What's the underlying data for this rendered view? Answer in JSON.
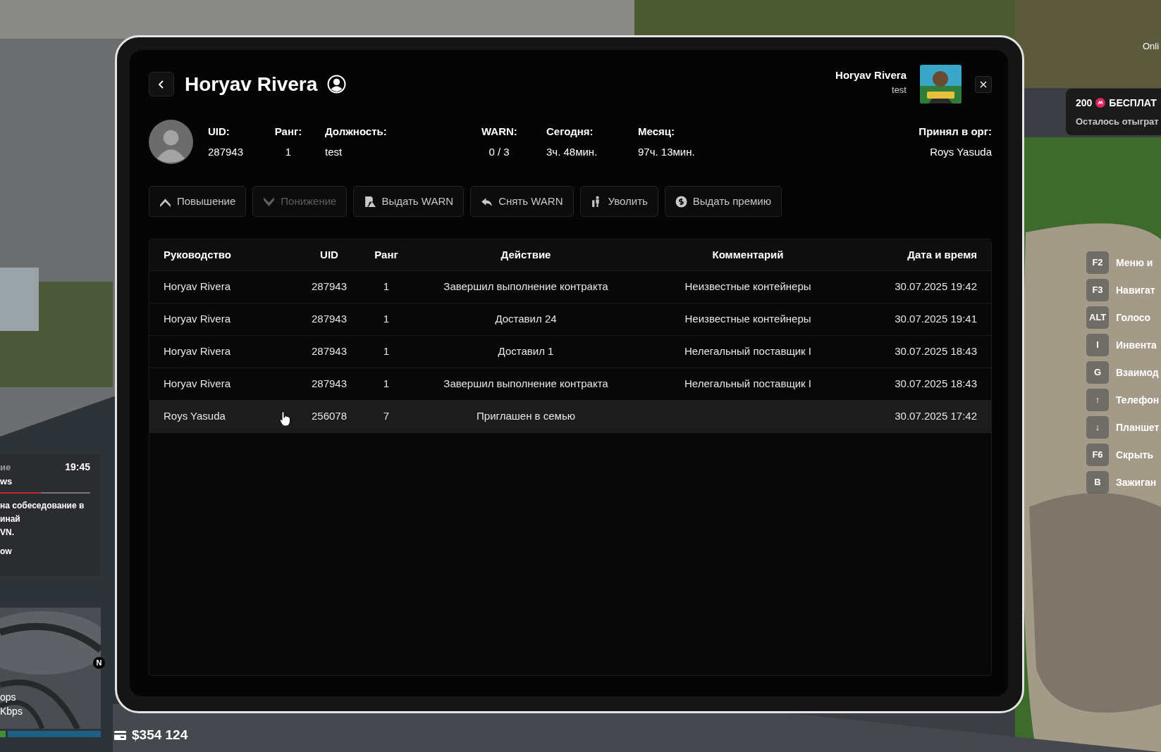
{
  "hud": {
    "top_right": {
      "status": "Onli"
    },
    "promo": {
      "amount": "200",
      "title": "БЕСПЛАТ",
      "subtitle": "Осталось отыграт"
    },
    "keybinds": [
      {
        "key": "F2",
        "label": "Меню и"
      },
      {
        "key": "F3",
        "label": "Навигат"
      },
      {
        "key": "ALT",
        "label": "Голосо"
      },
      {
        "key": "I",
        "label": "Инвента"
      },
      {
        "key": "G",
        "label": "Взаимод"
      },
      {
        "key": "↑",
        "label": "Телефон"
      },
      {
        "key": "↓",
        "label": "Планшет"
      },
      {
        "key": "F6",
        "label": "Скрыть"
      },
      {
        "key": "B",
        "label": "Зажиган"
      }
    ],
    "chat": {
      "title": "ие",
      "time": "19:45",
      "sender": "ws",
      "level": 0.45,
      "lines": [
        "на собеседование в",
        "инай",
        "VN."
      ],
      "footer": "ow"
    },
    "minimap": {
      "compass": "N",
      "net_lines": [
        "ops",
        "Kbps"
      ]
    },
    "money": {
      "bank": "$354 124"
    }
  },
  "tablet": {
    "title": "Horyav Rivera",
    "user": {
      "name": "Horyav Rivera",
      "role": "test"
    },
    "stats": [
      {
        "label": "UID:",
        "value": "287943"
      },
      {
        "label": "Ранг:",
        "value": "1"
      },
      {
        "label": "Должность:",
        "value": "test"
      },
      {
        "label": "WARN:",
        "value": "0 / 3"
      },
      {
        "label": "Сегодня:",
        "value": "3ч. 48мин."
      },
      {
        "label": "Месяц:",
        "value": "97ч. 13мин."
      }
    ],
    "accepted": {
      "label": "Принял в орг:",
      "value": "Roys Yasuda"
    },
    "actions": [
      {
        "label": "Повышение",
        "kind": "up",
        "disabled": false
      },
      {
        "label": "Понижение",
        "kind": "down",
        "disabled": true
      },
      {
        "label": "Выдать WARN",
        "kind": "warn",
        "disabled": false
      },
      {
        "label": "Снять WARN",
        "kind": "undo",
        "disabled": false
      },
      {
        "label": "Уволить",
        "kind": "fire",
        "disabled": false
      },
      {
        "label": "Выдать премию",
        "kind": "coin",
        "disabled": false
      }
    ],
    "table": {
      "columns": [
        "Руководство",
        "UID",
        "Ранг",
        "Действие",
        "Комментарий",
        "Дата и время"
      ],
      "rows": [
        {
          "highlighted": false,
          "cells": [
            "Horyav Rivera",
            "287943",
            "1",
            "Завершил выполнение контракта",
            "Неизвестные контейнеры",
            "30.07.2025 19:42"
          ]
        },
        {
          "highlighted": false,
          "cells": [
            "Horyav Rivera",
            "287943",
            "1",
            "Доставил 24",
            "Неизвестные контейнеры",
            "30.07.2025 19:41"
          ]
        },
        {
          "highlighted": false,
          "cells": [
            "Horyav Rivera",
            "287943",
            "1",
            "Доставил 1",
            "Нелегальный поставщик I",
            "30.07.2025 18:43"
          ]
        },
        {
          "highlighted": false,
          "cells": [
            "Horyav Rivera",
            "287943",
            "1",
            "Завершил выполнение контракта",
            "Нелегальный поставщик I",
            "30.07.2025 18:43"
          ]
        },
        {
          "highlighted": true,
          "cells": [
            "Roys Yasuda",
            "256078",
            "7",
            "Приглашен в семью",
            "",
            "30.07.2025 17:42"
          ]
        }
      ]
    }
  }
}
